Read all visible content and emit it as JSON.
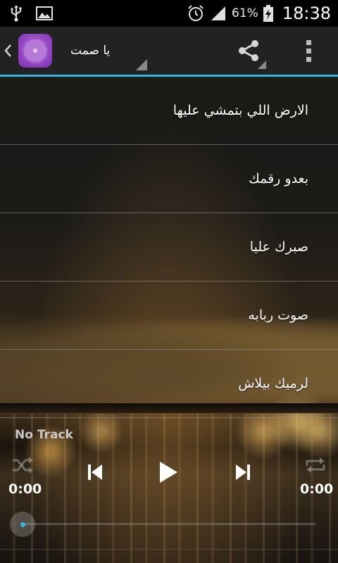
{
  "status_bar": {
    "battery_text": "61%",
    "time": "18:38",
    "icons": [
      "usb-icon",
      "image-icon",
      "alarm-icon",
      "signal-icon",
      "battery-charging-icon"
    ]
  },
  "action_bar": {
    "title": "يا صمت",
    "icons": [
      "chevron-left-icon",
      "app-logo",
      "share-icon",
      "overflow-menu-icon"
    ],
    "accent_color": "#33b5e5"
  },
  "songs": [
    {
      "title": "الارض اللي بتمشي عليها"
    },
    {
      "title": "بعدو رقمك"
    },
    {
      "title": "صبرك عليا"
    },
    {
      "title": "صوت ربابه"
    },
    {
      "title": "لرميك بيلاش"
    }
  ],
  "player": {
    "track_name": "No Track",
    "elapsed": "0:00",
    "duration": "0:00",
    "progress": 0,
    "controls": [
      "shuffle-icon",
      "previous-icon",
      "play-icon",
      "next-icon",
      "repeat-icon"
    ]
  }
}
